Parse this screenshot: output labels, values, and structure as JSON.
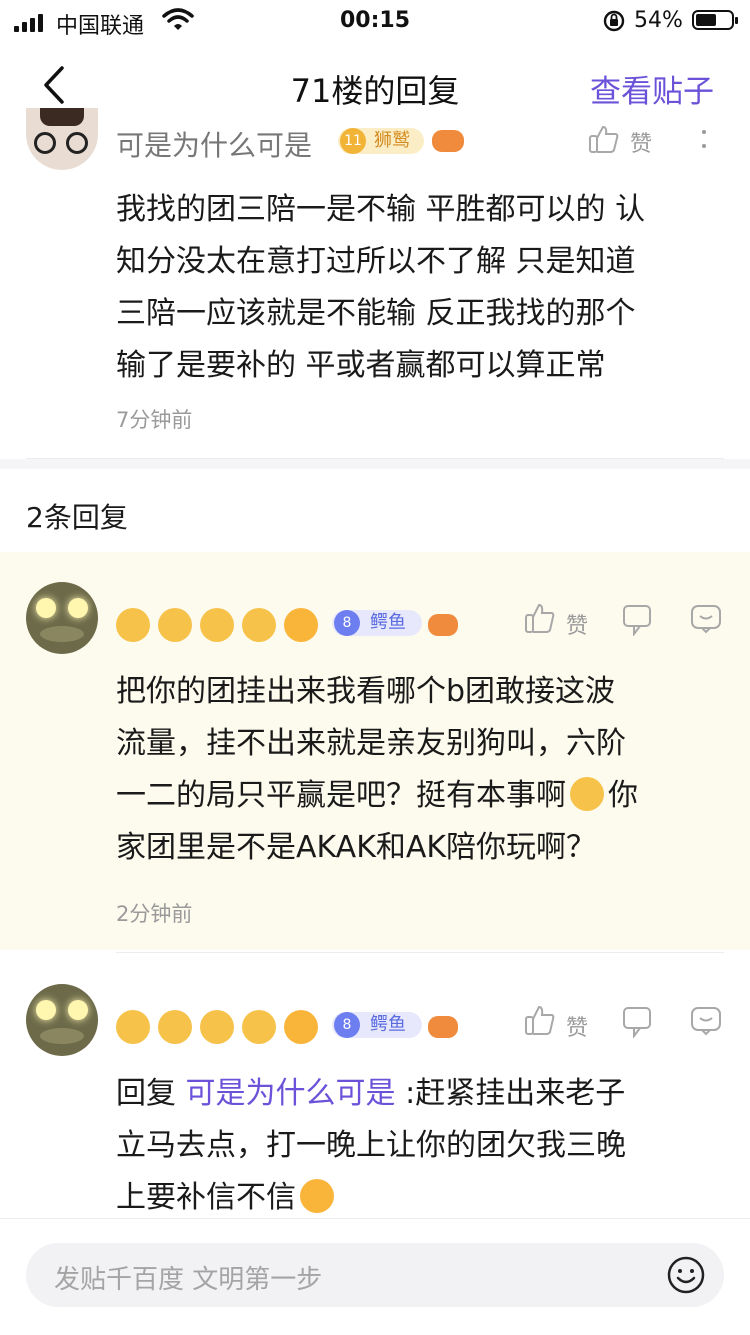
{
  "status_bar": {
    "carrier": "中国联通",
    "time": "00:15",
    "battery": "54%"
  },
  "nav": {
    "title": "71楼的回复",
    "view_post": "查看贴子"
  },
  "main_post": {
    "username": "可是为什么可是",
    "level": "11",
    "level_title": "狮鹫",
    "like_label": "赞",
    "content_lines": [
      "我找的团三陪一是不输 平胜都可以的 认",
      "知分没太在意打过所以不了解 只是知道",
      "三陪一应该就是不能输 反正我找的那个",
      "输了是要补的 平或者赢都可以算正常"
    ],
    "time": "7分钟前"
  },
  "reply_count": "2条回复",
  "replies": [
    {
      "level": "8",
      "level_title": "鳄鱼",
      "like_label": "赞",
      "content_lines": [
        "把你的团挂出来我看哪个b团敢接这波",
        "流量，挂不出来就是亲友别狗叫，六阶",
        "一二的局只平赢是吧？挺有本事啊",
        "家团里是不是AKAK和AK陪你玩啊？"
      ],
      "line3_tail": "你",
      "time": "2分钟前"
    },
    {
      "level": "8",
      "level_title": "鳄鱼",
      "like_label": "赞",
      "reply_prefix": "回复 ",
      "reply_to": "可是为什么可是",
      "reply_text": " :赶紧挂出来老子",
      "content_lines": [
        "立马去点，打一晚上让你的团欠我三晚",
        "上要补信不信"
      ]
    }
  ],
  "input": {
    "placeholder": "发贴千百度 文明第一步"
  }
}
